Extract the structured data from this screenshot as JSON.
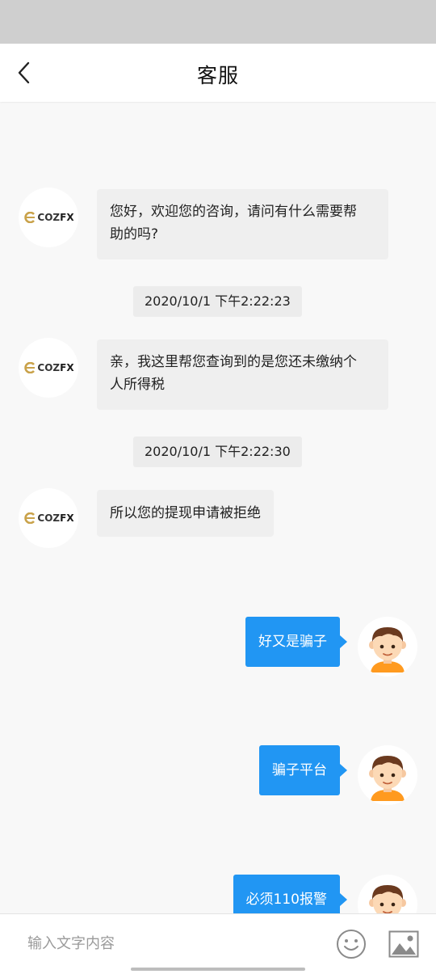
{
  "header": {
    "title": "客服",
    "back_icon": "chevron-left-icon"
  },
  "agent": {
    "logo_text_coz": "COZ",
    "logo_text_fx": "FX",
    "logo_accent": "#c9a24a"
  },
  "messages": [
    {
      "from": "agent",
      "text_line1": "您好，欢迎您的咨询，请问有什么需要帮",
      "text_line2": "助的吗?"
    },
    {
      "timestamp": "2020/10/1 下午2:22:23"
    },
    {
      "from": "agent",
      "text_line1": "亲，我这里帮您查询到的是您还未缴纳个",
      "text_line2": "人所得税"
    },
    {
      "timestamp": "2020/10/1 下午2:22:30"
    },
    {
      "from": "agent",
      "text_line1": "所以您的提现申请被拒绝"
    },
    {
      "from": "user",
      "text": "好又是骗子"
    },
    {
      "from": "user",
      "text": "骗子平台"
    },
    {
      "from": "user",
      "text": "必须110报警"
    }
  ],
  "input": {
    "placeholder": "输入文字内容",
    "value": "",
    "emoji_icon": "smiley-icon",
    "image_icon": "image-icon"
  },
  "colors": {
    "accent": "#2196f3",
    "agent_bubble": "#efefef",
    "timestamp_bg": "#ececec",
    "background": "#f8f8f8"
  }
}
